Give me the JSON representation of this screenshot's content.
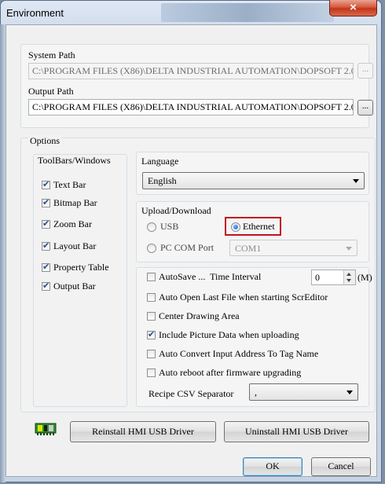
{
  "window": {
    "title": "Environment",
    "close_glyph": "×"
  },
  "system_path": {
    "label": "System Path",
    "value": "C:\\PROGRAM FILES (X86)\\DELTA INDUSTRIAL AUTOMATION\\DOPSOFT 2.0",
    "browse_label": "..."
  },
  "output_path": {
    "label": "Output Path",
    "value": "C:\\PROGRAM FILES (X86)\\DELTA INDUSTRIAL AUTOMATION\\DOPSOFT 2.0",
    "browse_label": "..."
  },
  "options": {
    "label": "Options",
    "toolbars": {
      "label": "ToolBars/Windows",
      "items": [
        {
          "label": "Text Bar",
          "checked": true
        },
        {
          "label": "Bitmap Bar",
          "checked": true
        },
        {
          "label": "Zoom Bar",
          "checked": true
        },
        {
          "label": "Layout Bar",
          "checked": true
        },
        {
          "label": "Property Table",
          "checked": true
        },
        {
          "label": "Output Bar",
          "checked": true
        }
      ]
    },
    "language": {
      "label": "Language",
      "selected": "English"
    },
    "upload_download": {
      "label": "Upload/Download",
      "usb_label": "USB",
      "ethernet_label": "Ethernet",
      "pc_com_label": "PC COM Port",
      "com_port_value": "COM1",
      "selected": "Ethernet"
    },
    "autosave": {
      "label": "AutoSave ...  Time Interval",
      "checked": false,
      "value": "0",
      "unit": "(M)"
    },
    "flags": [
      {
        "label": "Auto Open Last File when starting ScrEditor",
        "checked": false
      },
      {
        "label": "Center Drawing Area",
        "checked": false
      },
      {
        "label": "Include Picture Data when uploading",
        "checked": true
      },
      {
        "label": "Auto Convert Input Address To Tag Name",
        "checked": false
      },
      {
        "label": "Auto reboot after firmware upgrading",
        "checked": false
      }
    ],
    "recipe": {
      "label": "Recipe CSV Separator",
      "value": ","
    }
  },
  "buttons": {
    "reinstall": "Reinstall HMI USB Driver",
    "uninstall": "Uninstall HMI USB Driver",
    "ok": "OK",
    "cancel": "Cancel"
  },
  "colors": {
    "highlight": "#c0141e",
    "chip": "#2f8f2f"
  }
}
